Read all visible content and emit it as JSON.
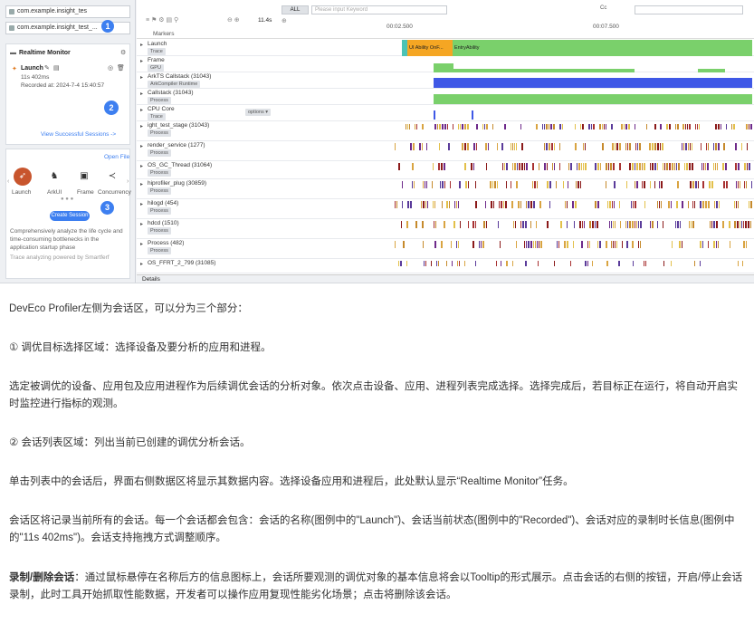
{
  "left_panel": {
    "device_app": "com.example.insight_tes",
    "device_process": "com.example.insight_test_...",
    "realtime_monitor": "Realtime Monitor",
    "session_name": "Launch",
    "session_duration": "11s 402ms",
    "session_recorded": "Recorded at: 2024-7-4 15:40:57",
    "view_successful": "View Successful Sessions ->",
    "open_file": "Open File",
    "templates": [
      "Launch",
      "ArkUI",
      "Frame",
      "Concurrency"
    ],
    "create_session": "Create Session",
    "description": "Comprehensively analyze the life cycle and time-consuming bottlenecks in the application startup phase",
    "powered_by": "Trace analyzing powered by Smartferf",
    "badges": [
      "1",
      "2",
      "3"
    ]
  },
  "toolbar": {
    "filter_all": "ALL",
    "search_placeholder": "Please input Keyword",
    "cc": "Cc",
    "duration": "11.4s",
    "markers": "Markers",
    "time_ticks": [
      "00:02.500",
      "00:07.500"
    ]
  },
  "rows": [
    {
      "name": "Launch",
      "tag": "Trace"
    },
    {
      "name": "Frame",
      "tag": "GPU"
    },
    {
      "name": "ArkTS Callstack (31043)",
      "tag": "ArkCompiler Runtime"
    },
    {
      "name": "Callstack (31043)",
      "tag": "Process"
    },
    {
      "name": "CPU Core",
      "tag": "Trace",
      "options": "options"
    },
    {
      "name": "ight_test_stage (31043)",
      "tag": "Process"
    },
    {
      "name": "render_service (1277)",
      "tag": "Process"
    },
    {
      "name": "OS_GC_Thread (31064)",
      "tag": "Process"
    },
    {
      "name": "hiprofiler_plug (30859)",
      "tag": "Process"
    },
    {
      "name": "hilogd (454)",
      "tag": "Process"
    },
    {
      "name": "hdcd (1510)",
      "tag": "Process"
    },
    {
      "name": "Process (482)",
      "tag": "Process"
    },
    {
      "name": "OS_FFRT_2_799 (31085)",
      "tag": ""
    }
  ],
  "launch_track": {
    "seg1": "UI Ability OnF...",
    "seg2": "EntryAbility"
  },
  "details": "Details",
  "prose": {
    "p1": "DevEco Profiler左侧为会话区，可以分为三个部分：",
    "p2": "① 调优目标选择区域：选择设备及要分析的应用和进程。",
    "p3": "选定被调优的设备、应用包及应用进程作为后续调优会话的分析对象。依次点击设备、应用、进程列表完成选择。选择完成后，若目标正在运行，将自动开启实时监控进行指标的观测。",
    "p4": "② 会话列表区域：列出当前已创建的调优分析会话。",
    "p5": "单击列表中的会话后，界面右侧数据区将显示其数据内容。选择设备应用和进程后，此处默认显示“Realtime Monitor”任务。",
    "p6": "会话区将记录当前所有的会话。每一个会话都会包含：会话的名称(图例中的\"Launch\")、会话当前状态(图例中的\"Recorded\")、会话对应的录制时长信息(图例中的\"11s 402ms\")。会话支持拖拽方式调整顺序。",
    "p7_bold": "录制/删除会话",
    "p7": "：通过鼠标悬停在名称后方的信息图标上，会话所要观测的调优对象的基本信息将会以Tooltip的形式展示。点击会话的右侧的按钮，开启/停止会话录制，此时工具开始抓取性能数据，开发者可以操作应用复现性能劣化场景；点击将删除该会话。"
  },
  "colors": {
    "accent": "#3d7ff0",
    "green": "#7ad06b",
    "blue": "#3f58e6",
    "orange": "#f5a623",
    "teal": "#4cc3b5"
  }
}
